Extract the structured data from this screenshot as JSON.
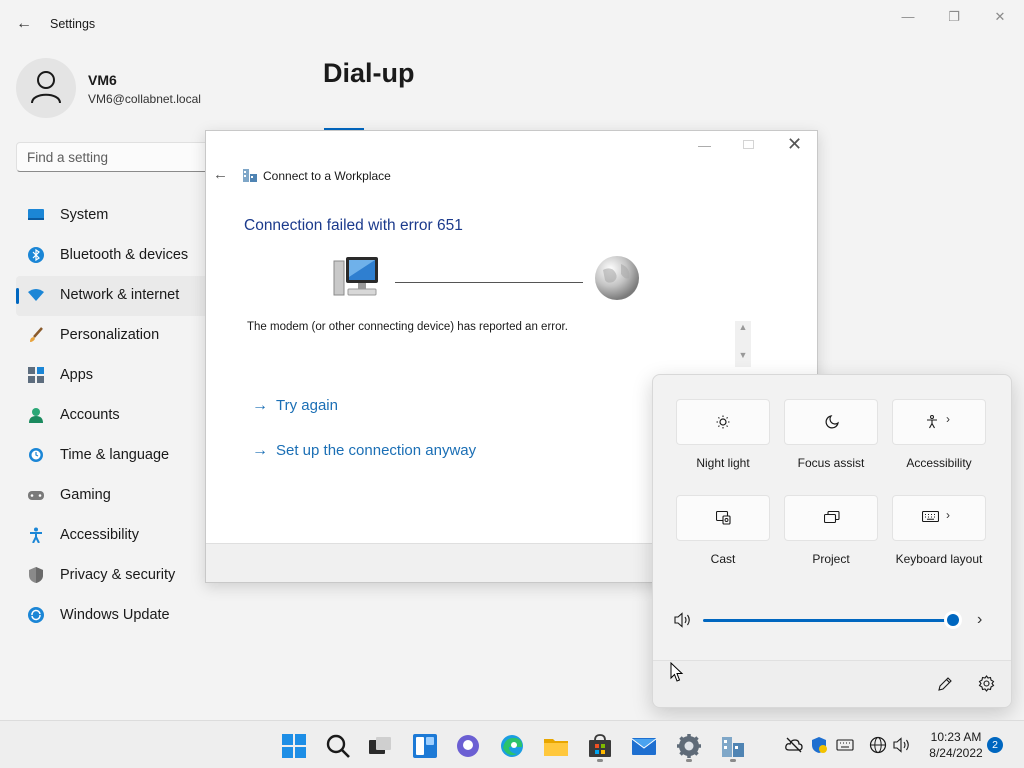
{
  "window": {
    "app_title": "Settings",
    "minimize": "—",
    "maximize": "❐",
    "close": "✕"
  },
  "user": {
    "name": "VM6",
    "email": "VM6@collabnet.local"
  },
  "search": {
    "placeholder": "Find a setting"
  },
  "nav": {
    "items": [
      {
        "label": "System",
        "icon": "system-icon"
      },
      {
        "label": "Bluetooth & devices",
        "icon": "bluetooth-icon"
      },
      {
        "label": "Network & internet",
        "icon": "network-icon",
        "active": true
      },
      {
        "label": "Personalization",
        "icon": "brush-icon"
      },
      {
        "label": "Apps",
        "icon": "apps-icon"
      },
      {
        "label": "Accounts",
        "icon": "accounts-icon"
      },
      {
        "label": "Time & language",
        "icon": "time-language-icon"
      },
      {
        "label": "Gaming",
        "icon": "gaming-icon"
      },
      {
        "label": "Accessibility",
        "icon": "accessibility-icon"
      },
      {
        "label": "Privacy & security",
        "icon": "shield-icon"
      },
      {
        "label": "Windows Update",
        "icon": "windows-update-icon"
      }
    ]
  },
  "page": {
    "title": "Dial-up"
  },
  "dialog": {
    "title": "Connect to a Workplace",
    "heading": "Connection failed with error 651",
    "message": "The modem (or other connecting device) has reported an error.",
    "try_again": "Try again",
    "setup_anyway": "Set up the connection anyway"
  },
  "quick_settings": {
    "tiles": [
      {
        "label": "Night light",
        "icon": "night-light-icon"
      },
      {
        "label": "Focus assist",
        "icon": "focus-assist-icon"
      },
      {
        "label": "Accessibility",
        "icon": "accessibility-icon"
      },
      {
        "label": "Cast",
        "icon": "cast-icon"
      },
      {
        "label": "Project",
        "icon": "project-icon"
      },
      {
        "label": "Keyboard layout",
        "icon": "keyboard-icon"
      }
    ],
    "volume_level": 1.0
  },
  "taskbar": {
    "time": "10:23 AM",
    "date": "8/24/2022",
    "notification_count": "2"
  },
  "colors": {
    "accent": "#0067c0",
    "link": "#1b6fb5",
    "heading": "#1b3a8c"
  }
}
